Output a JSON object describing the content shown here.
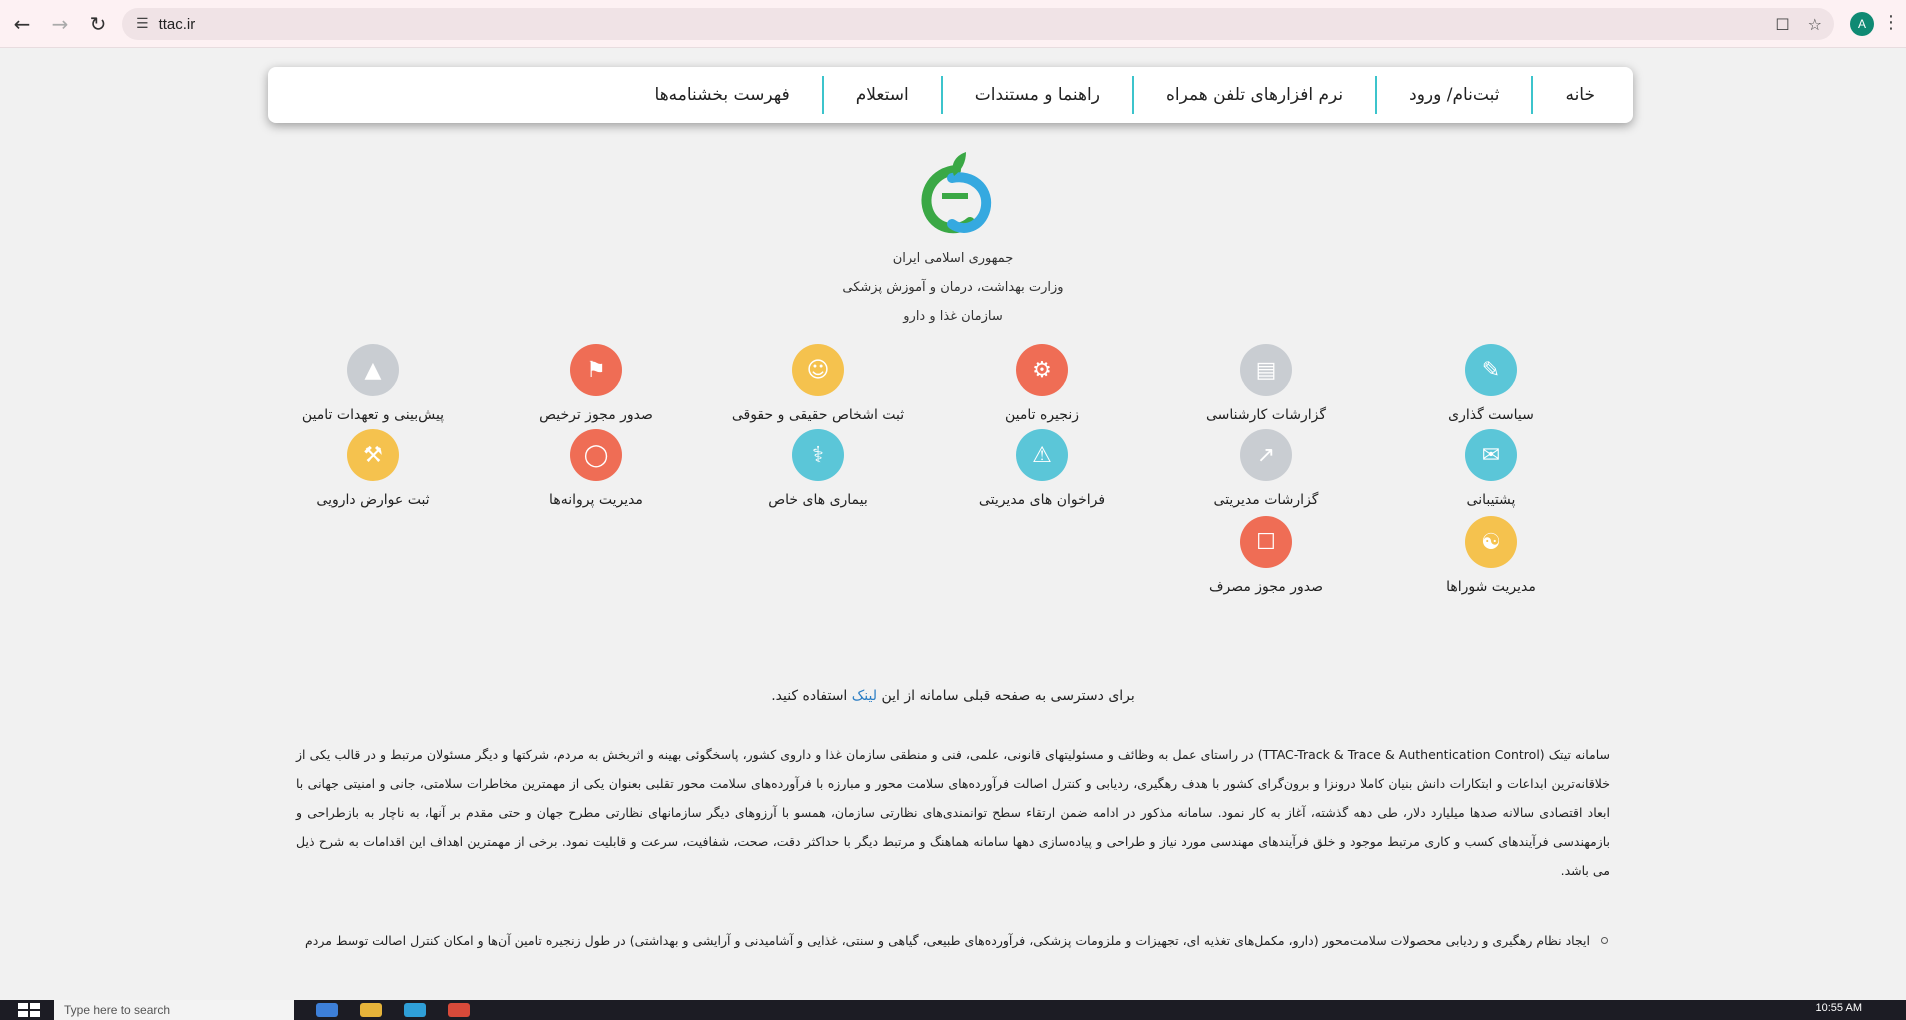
{
  "browser": {
    "url": "ttac.ir",
    "profile_initial": "A"
  },
  "nav": {
    "items": [
      "خانه",
      "ثبت‌نام/ ورود",
      "نرم افزارهای تلفن همراه",
      "راهنما و مستندات",
      "استعلام",
      "فهرست بخشنامه‌ها"
    ]
  },
  "org": {
    "line1": "جمهوری اسلامی ایران",
    "line2": "وزارت بهداشت، درمان و آموزش پزشکی",
    "line3": "سازمان غذا و دارو"
  },
  "services": [
    {
      "label": "سیاست گذاری",
      "icon": "policy-icon",
      "color": "#5bc6d8"
    },
    {
      "label": "گزارشات کارشناسی",
      "icon": "report-icon",
      "color": "#c9cdd2"
    },
    {
      "label": "زنجیره تامین",
      "icon": "supply-chain-icon",
      "color": "#ef6d55"
    },
    {
      "label": "ثبت اشخاص حقیقی و حقوقی",
      "icon": "people-icon",
      "color": "#f5c24e"
    },
    {
      "label": "صدور مجوز ترخیص",
      "icon": "map-icon",
      "color": "#ef6d55"
    },
    {
      "label": "پیش‌بینی و تعهدات تامین",
      "icon": "forecast-icon",
      "color": "#c9cdd2"
    },
    {
      "label": "پشتیبانی",
      "icon": "support-icon",
      "color": "#5bc6d8"
    },
    {
      "label": "گزارشات مدیریتی",
      "icon": "chart-icon",
      "color": "#c9cdd2"
    },
    {
      "label": "فراخوان های مدیریتی",
      "icon": "recall-icon",
      "color": "#5bc6d8"
    },
    {
      "label": "بیماری های خاص",
      "icon": "medicine-icon",
      "color": "#5bc6d8"
    },
    {
      "label": "مدیریت پروانه‌ها",
      "icon": "license-icon",
      "color": "#ef6d55"
    },
    {
      "label": "ثبت عوارض دارویی",
      "icon": "drug-bottle-icon",
      "color": "#f5c24e"
    },
    {
      "label": "مدیریت شوراها",
      "icon": "council-icon",
      "color": "#f5c24e"
    },
    {
      "label": "صدور مجوز مصرف",
      "icon": "consumption-icon",
      "color": "#ef6d55"
    }
  ],
  "note": {
    "before": "برای دسترسی به صفحه قبلی سامانه از این ",
    "link": "لینک",
    "after": " استفاده کنید."
  },
  "intro": "سامانه تیتک (TTAC-Track & Trace & Authentication Control) در راستای عمل به وظائف و مسئولیتهای قانونی، علمی، فنی و منطقی سازمان غذا و داروی کشور، پاسخگوئی بهینه و اثربخش به مردم، شرکتها و دیگر مسئولان مرتبط و در قالب یکی از خلاقانه‌ترین ابداعات و ابتکارات دانش بنیان کاملا درونزا و برون‌گرای کشور با هدف رهگیری، ردیابی و کنترل اصالت فرآورده‌های سلامت محور و مبارزه با فرآورده‌های سلامت محور تقلبی بعنوان یکی از مهمترین مخاطرات سلامتی، جانی و امنیتی جهانی با ابعاد اقتصادی سالانه صدها میلیارد دلار، طی دهه گذشته، آغاز به کار نمود. سامانه مذکور در ادامه ضمن ارتقاء سطح توانمندی‌های نظارتی سازمان، همسو با آرزوهای دیگر سازمانهای نظارتی مطرح جهان و حتی مقدم بر آنها، به ناچار به بازطراحی و بازمهندسی فرآیندهای کسب و کاری مرتبط موجود و خلق فرآیندهای مهندسی مورد نیاز و طراحی و پیاده‌سازی دهها سامانه هماهنگ و مرتبط دیگر با حداکثر دقت، صحت، شفافیت، سرعت و قابلیت نمود. برخی از مهمترین اهداف این اقدامات به شرح ذیل می باشد.",
  "bullets": [
    "ایجاد نظام رهگیری و ردیابی محصولات سلامت‌محور (دارو، مکمل‌های تغذیه ای، تجهیزات و ملزومات پزشکی، فرآورده‌های طبیعی، گیاهی و سنتی، غذایی و آشامیدنی و آرایشی و بهداشتی) در طول زنجیره تامین آن‌ها و امکان کنترل اصالت توسط مردم"
  ],
  "taskbar": {
    "search_placeholder": "Type here to search",
    "time": "10:55 AM"
  }
}
